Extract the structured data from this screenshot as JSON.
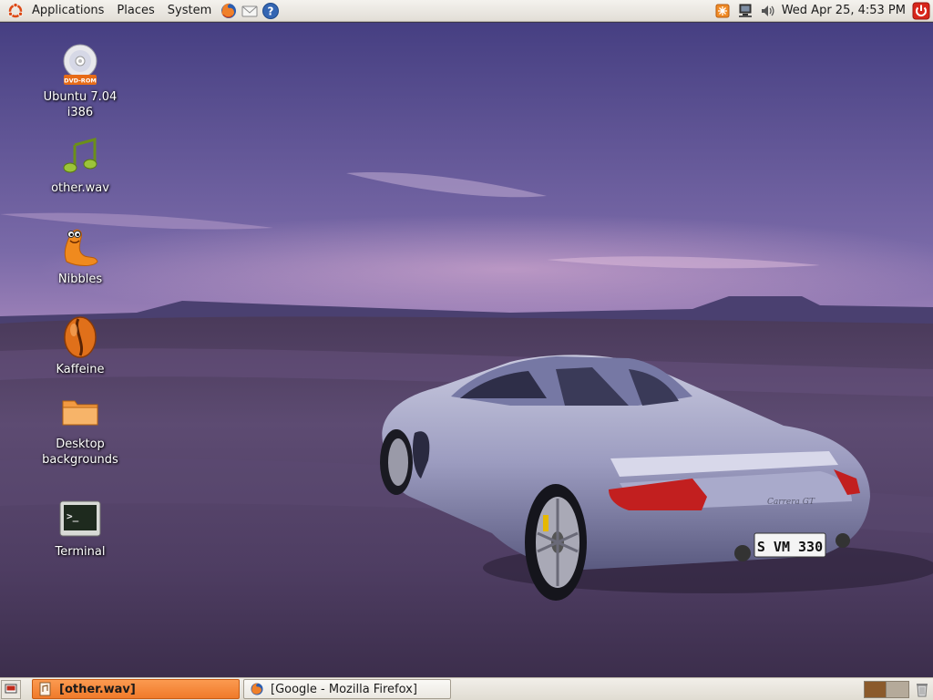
{
  "top_panel": {
    "menus": [
      {
        "label": "Applications"
      },
      {
        "label": "Places"
      },
      {
        "label": "System"
      }
    ],
    "launchers": [
      "firefox-icon",
      "mail-icon",
      "help-icon"
    ],
    "tray_icons": [
      "update-notifier-icon",
      "network-icon",
      "volume-icon"
    ],
    "clock": "Wed Apr 25,  4:53 PM",
    "power_icon": "power-icon"
  },
  "desktop": {
    "icons": [
      {
        "label": "Ubuntu 7.04 i386",
        "icon": "dvd-icon",
        "badge": "DVD-ROM"
      },
      {
        "label": "other.wav",
        "icon": "music-note-icon"
      },
      {
        "label": "Nibbles",
        "icon": "nibbles-icon"
      },
      {
        "label": "Kaffeine",
        "icon": "kaffeine-icon"
      },
      {
        "label": "Desktop backgrounds",
        "icon": "folder-icon"
      },
      {
        "label": "Terminal",
        "icon": "terminal-icon"
      }
    ],
    "wallpaper": {
      "plate": "S VM 330",
      "badge": "Carrera GT"
    }
  },
  "bottom_panel": {
    "tasks": [
      {
        "label": "[other.wav]",
        "active": true,
        "icon": "audio-file-icon"
      },
      {
        "label": "[Google - Mozilla Firefox]",
        "active": false,
        "icon": "firefox-icon"
      }
    ],
    "workspaces": [
      {
        "color": "#8b5a2b"
      },
      {
        "color": "#b5aa9a"
      }
    ]
  },
  "colors": {
    "panel": "#e8e5de",
    "active_task": "#f58a3c",
    "sky_top": "#4a4185",
    "sky_horizon": "#d4a6d0"
  }
}
